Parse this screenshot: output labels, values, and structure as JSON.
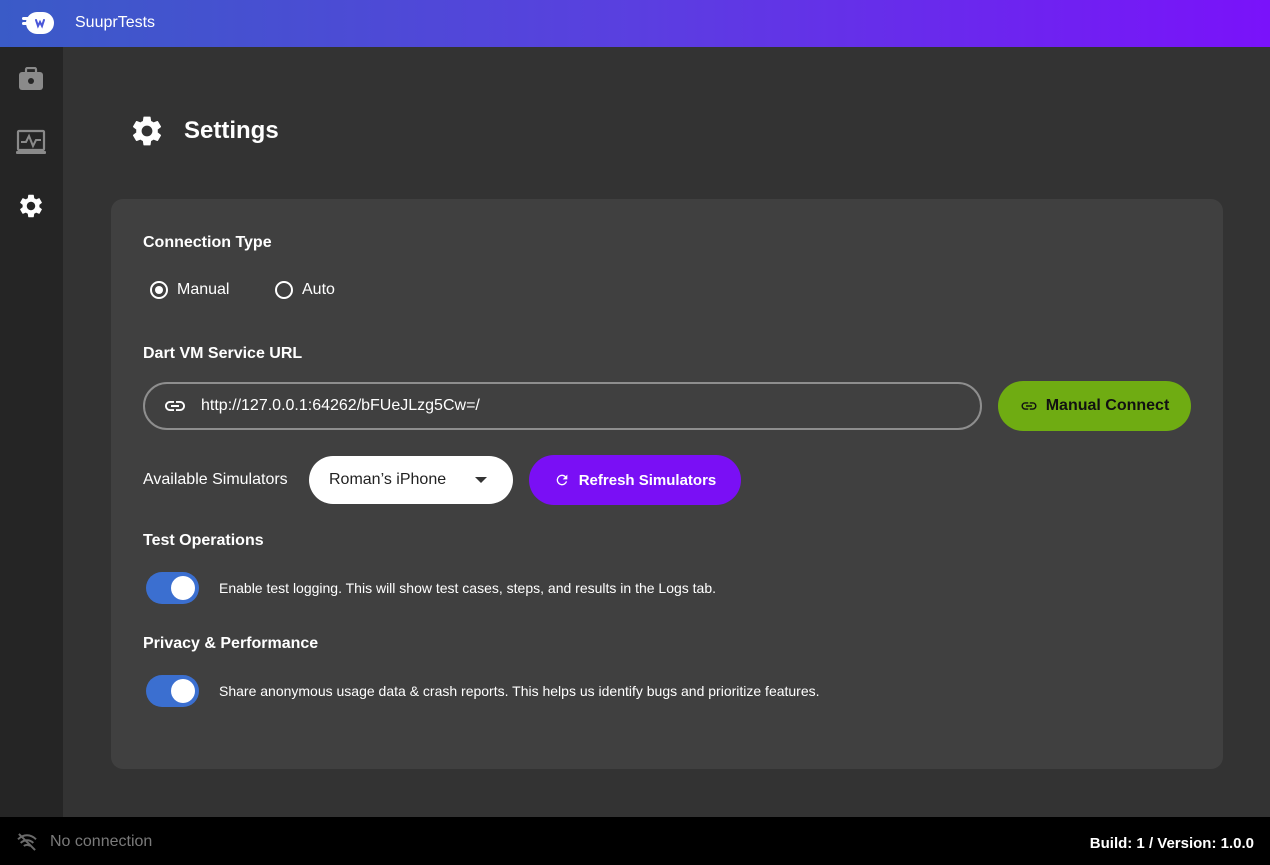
{
  "app": {
    "title": "SuuprTests"
  },
  "sidebar": {
    "items": [
      {
        "icon": "briefcase-icon"
      },
      {
        "icon": "monitor-chart-icon"
      },
      {
        "icon": "gear-icon"
      }
    ]
  },
  "page": {
    "title": "Settings",
    "icon": "gear-icon"
  },
  "connection": {
    "title": "Connection Type",
    "options": [
      "Manual",
      "Auto"
    ],
    "selected": "Manual"
  },
  "vm": {
    "title": "Dart VM Service URL",
    "url": "http://127.0.0.1:64262/bFUeJLzg5Cw=/",
    "connect_label": "Manual Connect"
  },
  "simulators": {
    "label": "Available Simulators",
    "selected": "Roman’s iPhone",
    "refresh_label": "Refresh Simulators"
  },
  "test_ops": {
    "title": "Test Operations",
    "logging_text": "Enable test logging. This will show test cases, steps, and results in the Logs tab.",
    "logging_enabled": true
  },
  "privacy": {
    "title": "Privacy & Performance",
    "share_text": "Share anonymous usage data & crash reports. This helps us identify bugs and prioritize features.",
    "share_enabled": true
  },
  "status": {
    "connection": "No connection",
    "build": "Build: 1 / Version: 1.0.0"
  },
  "colors": {
    "accent_green": "#6fac12",
    "accent_purple": "#7a0ff5",
    "toggle_blue": "#3b6fd0"
  }
}
